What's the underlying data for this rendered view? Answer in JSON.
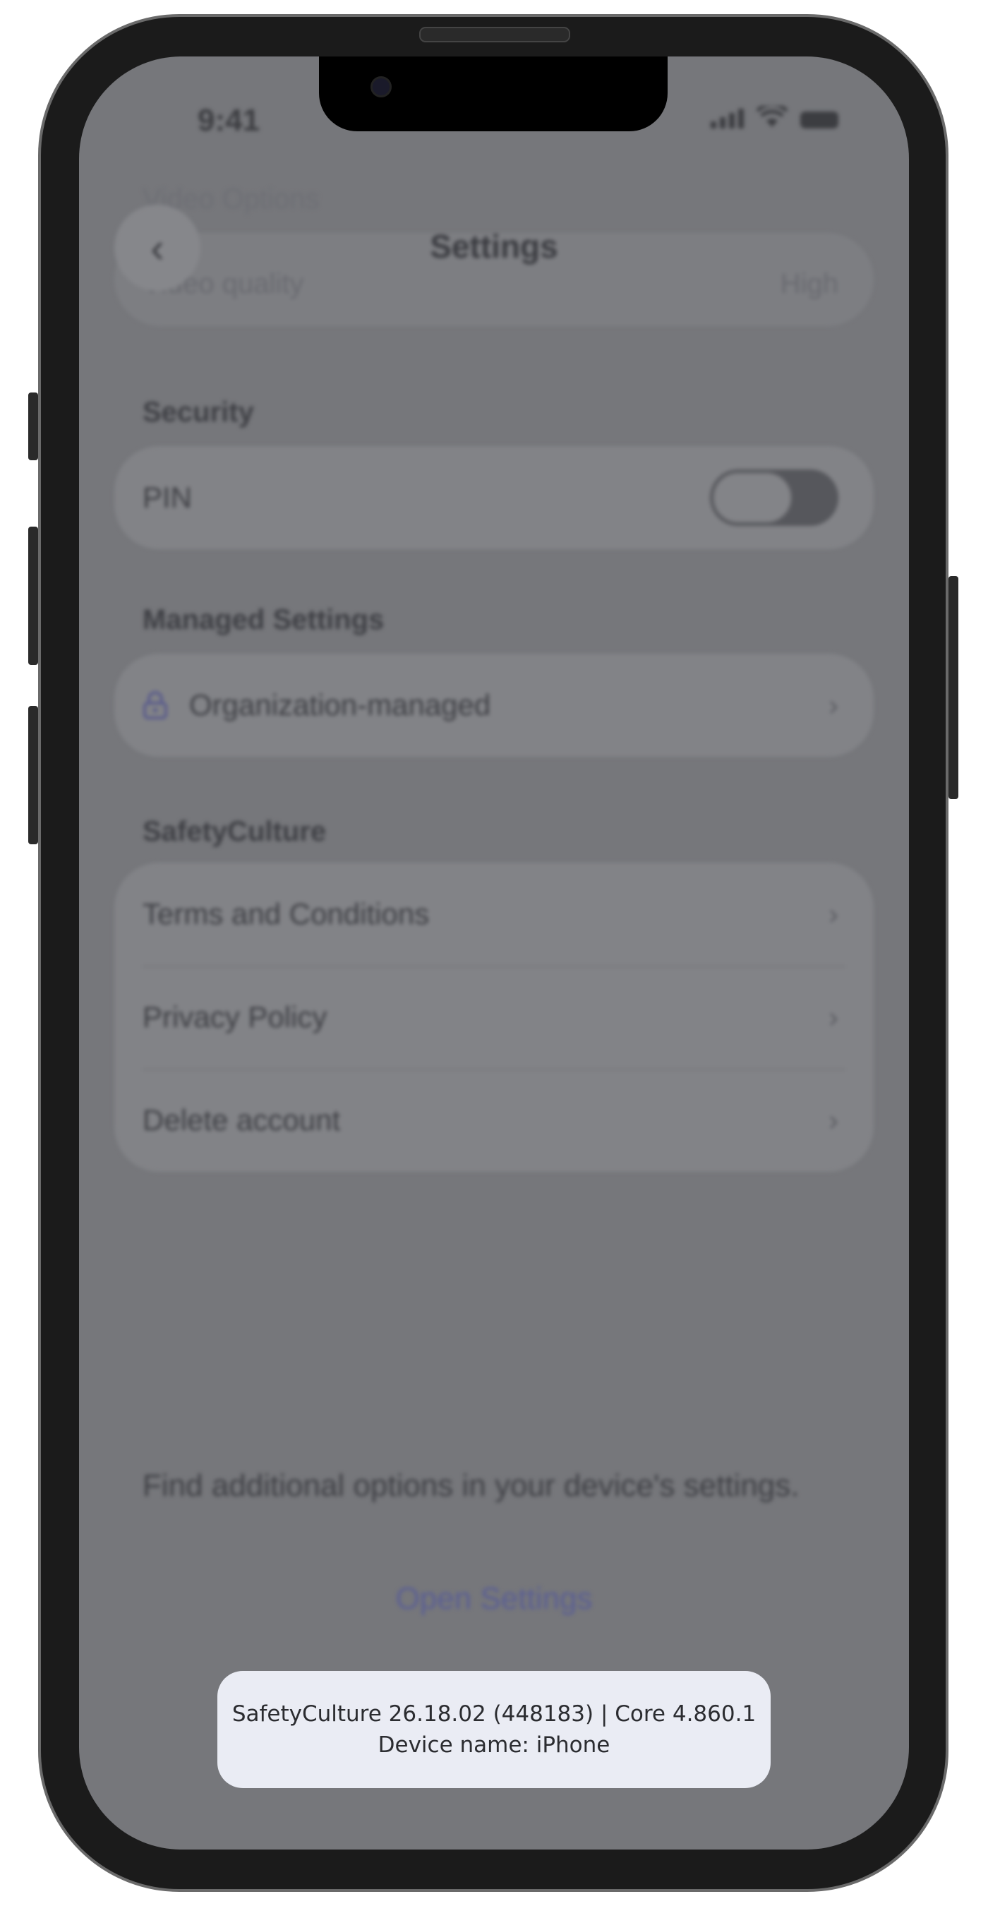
{
  "status_bar": {
    "time": "9:41"
  },
  "nav": {
    "title": "Settings"
  },
  "ghost": {
    "section": "Video Options",
    "row_label": "Video quality",
    "row_value": "High"
  },
  "security": {
    "label": "Security",
    "pin_label": "PIN",
    "pin_enabled": false
  },
  "managed": {
    "label": "Managed Settings",
    "row_label": "Organization-managed"
  },
  "safetyculture": {
    "label": "SafetyCulture",
    "items": [
      {
        "label": "Terms and Conditions"
      },
      {
        "label": "Privacy Policy"
      },
      {
        "label": "Delete account"
      }
    ]
  },
  "footer": {
    "note": "Find additional options in your device's settings.",
    "open_settings": "Open Settings"
  },
  "toast": {
    "version": "SafetyCulture 26.18.02 (448183) | Core 4.860.1",
    "device": "Device name: iPhone"
  },
  "colors": {
    "accent": "#5a5e94",
    "overlay": "#76777b",
    "toast_bg": "#eaecf4"
  }
}
